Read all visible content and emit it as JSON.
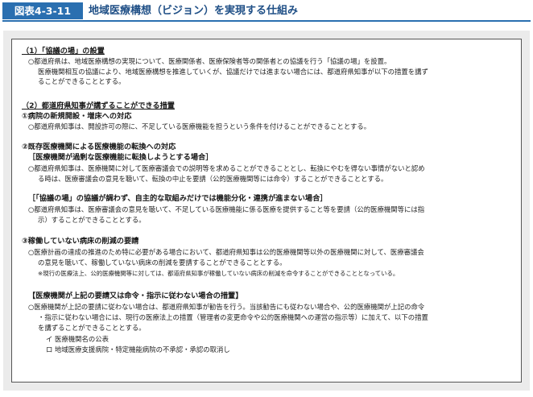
{
  "figure": {
    "label": "図表4-3-11",
    "title": "地域医療構想（ビジョン）を実現する仕組み"
  },
  "sections": {
    "s1": {
      "heading": "（1）「協議の場」の設置",
      "p1": "○都道府県は、地域医療構想の実現について、医療関係者、医療保険者等の関係者との協議を行う「協議の場」を設置。",
      "p2a": "医療機関相互の協議により、地域医療構想を推進していくが、協議だけでは進まない場合には、都道府県知事が以下の措置を講ず",
      "p2b": "ることができることとする。"
    },
    "s2": {
      "heading": "（2）都道府県知事が講ずることができる措置",
      "i1_title": "①病院の新規開設・増床への対応",
      "i1_p": "○都道府県知事は、開設許可の際に、不足している医療機能を担うという条件を付けることができることとする。",
      "i2_title": "②既存医療機関による医療機能の転換への対応",
      "i2_sub1": "［医療機関が過剰な医療機能に転換しようとする場合］",
      "i2_p1a": "○都道府県知事は、医療機関に対して医療審議会での説明等を求めることができることとし、転換にやむを得ない事情がないと認め",
      "i2_p1b": "る時は、医療審議会の意見を聴いて、転換の中止を要請（公的医療機関等には命令）することができることとする。",
      "i2_sub2": "［「協議の場」の協議が調わず、自主的な取組みだけでは機能分化・連携が進まない場合］",
      "i2_p2a": "○都道府県知事は、医療審議会の意見を聴いて、不足している医療機能に係る医療を提供すること等を要請（公的医療機関等には指",
      "i2_p2b": "示）することができることとする。",
      "i3_title": "③稼働していない病床の削減の要請",
      "i3_pa": "○医療計画の達成の推進のため特に必要がある場合において、都道府県知事は公的医療機関等以外の医療機関に対して、医療審議会",
      "i3_pb": "の意見を聴いて、稼働していない病床の削減を要請することができることとする。",
      "i3_note": "※現行の医療法上、公的医療機関等に対しては、都道府県知事が稼働していない病床の削減を命令することができることとなっている。",
      "i4_title": "【医療機関が上記の要請又は命令・指示に従わない場合の措置】",
      "i4_pa": "○医療機関が上記の要請に従わない場合は、都道府県知事が勧告を行う。当該勧告にも従わない場合や、公的医療機関が上記の命令",
      "i4_pb": "・指示に従わない場合には、現行の医療法上の措置（管理者の変更命令や公的医療機関への運営の指示等）に加えて、以下の措置",
      "i4_pc": "を講ずることができることとする。",
      "i4_list1": "イ 医療機関名の公表",
      "i4_list2": "ロ 地域医療支援病院・特定機能病院の不承認・承認の取消し"
    }
  }
}
